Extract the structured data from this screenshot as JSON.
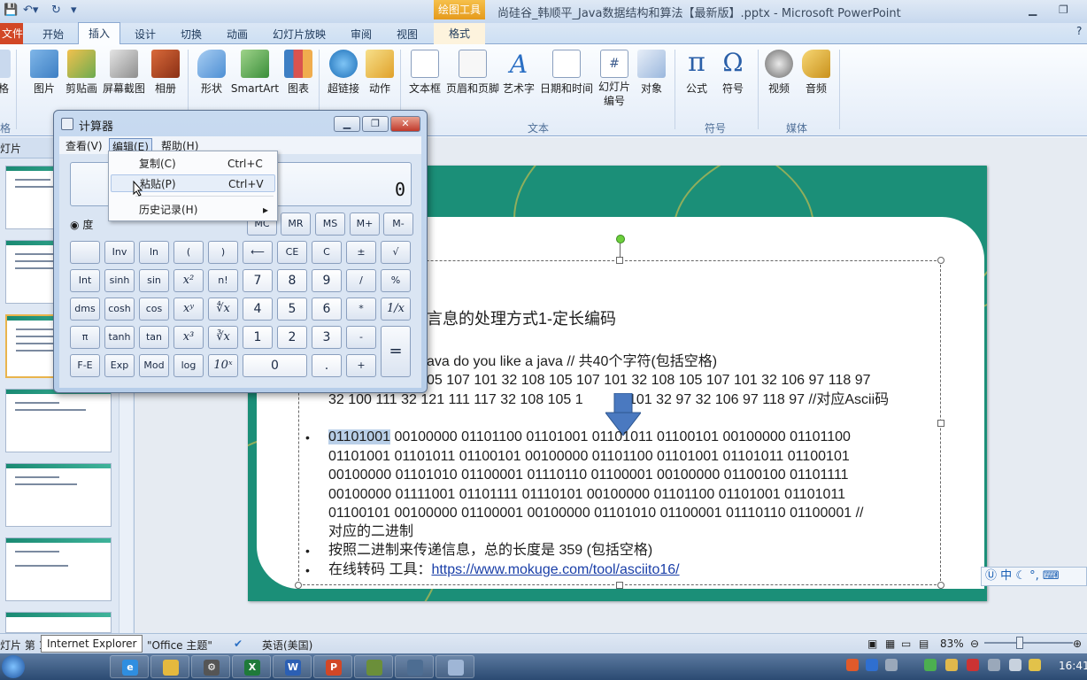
{
  "window": {
    "title": "尚硅谷_韩顺平_Java数据结构和算法【最新版】.pptx - Microsoft PowerPoint",
    "context_tab_group": "绘图工具"
  },
  "ribbon": {
    "tabs": {
      "file": "文件",
      "home": "开始",
      "insert": "插入",
      "design": "设计",
      "transitions": "切换",
      "animations": "动画",
      "slideshow": "幻灯片放映",
      "review": "审阅",
      "view": "视图",
      "format": "格式"
    },
    "buttons": {
      "table_partial": "格",
      "picture": "图片",
      "clipart": "剪贴画",
      "screenshot": "屏幕截图",
      "album": "相册",
      "shapes": "形状",
      "smartart": "SmartArt",
      "chart": "图表",
      "hyperlink": "超链接",
      "action": "动作",
      "textbox": "文本框",
      "header_footer": "页眉和页脚",
      "wordart": "艺术字",
      "datetime": "日期和时间",
      "slide_number_1": "幻灯片",
      "slide_number_2": "编号",
      "object": "对象",
      "equation": "公式",
      "symbol": "符号",
      "video": "视频",
      "audio": "音频"
    },
    "groups": {
      "table_partial": "格",
      "text": "文本",
      "symbols": "符号",
      "media": "媒体"
    }
  },
  "left_panel": {
    "tab_slides": "灯片"
  },
  "calculator": {
    "title": "计算器",
    "menu": {
      "view": "查看(V)",
      "edit": "编辑(E)",
      "help": "帮助(H)"
    },
    "display": "0",
    "radio_label": "度",
    "dropdown": {
      "copy": "复制(C)",
      "copy_shortcut": "Ctrl+C",
      "paste": "粘贴(P)",
      "paste_shortcut": "Ctrl+V",
      "history": "历史记录(H)",
      "history_arrow": "▸"
    },
    "keys": {
      "mc": "MC",
      "mr": "MR",
      "ms": "MS",
      "mplus": "M+",
      "mminus": "M-",
      "inv": "Inv",
      "ln": "ln",
      "lparen": "(",
      "rparen": ")",
      "back": "⟵",
      "ce": "CE",
      "c": "C",
      "pm": "±",
      "sqrt": "√",
      "int": "Int",
      "sinh": "sinh",
      "sin": "sin",
      "x2": "x²",
      "fact": "n!",
      "seven": "7",
      "eight": "8",
      "nine": "9",
      "div": "/",
      "pct": "%",
      "dms": "dms",
      "cosh": "cosh",
      "cos": "cos",
      "xy": "xʸ",
      "yroot": "∜x",
      "four": "4",
      "five": "5",
      "six": "6",
      "mul": "*",
      "recip": "1/x",
      "pi": "π",
      "tanh": "tanh",
      "tan": "tan",
      "x3": "x³",
      "cbrt": "∛x",
      "one": "1",
      "two": "2",
      "three": "3",
      "minus": "-",
      "equals": "=",
      "fe": "F-E",
      "exp": "Exp",
      "mod": "Mod",
      "log": "log",
      "tenx": "10ˣ",
      "zero": "0",
      "dot": ".",
      "plus": "+"
    }
  },
  "slide": {
    "title_fragment": "言息的处理方式1-定长编码",
    "line1": "ava do you like a java       // 共40个字符(包括空格)",
    "line2": "05 107 101 32 108 105 107 101 32 108 105 107 101 32 106 97 118 97",
    "line3": "32 100 111 32 121 111 117 32 108 105 1",
    "line3b": "101 32 97 32 106 97 118 97  //对应Ascii码",
    "binary_highlight": "01101001",
    "binary_l1": " 00100000 01101100 01101001 01101011 01100101 00100000 01101100",
    "binary_l2": "01101001 01101011 01100101 00100000 01101100 01101001 01101011 01100101",
    "binary_l3": "00100000 01101010 01100001 01110110 01100001 00100000 01100100 01101111",
    "binary_l4": "00100000 01111001 01101111 01110101 00100000 01101100 01101001 01101011",
    "binary_l5": "01100101 00100000 01100001 00100000 01101010 01100001 01110110 01100001 //",
    "binary_l6": "对应的二进制",
    "total_prefix": "按照二进制来传递信息，总的长度是  359  (包括空格)",
    "online_prefix": "在线转码 工具：",
    "online_link": "https://www.mokuge.com/tool/asciito16/",
    "bullet": "•"
  },
  "statusbar": {
    "slide_info": "灯片 第 1",
    "tooltip": "Internet Explorer",
    "theme": "\"Office 主题\"",
    "language": "英语(美国)",
    "zoom": "83%"
  },
  "ime": "中",
  "taskbar": {
    "clock": "16:41"
  },
  "colors": {
    "accent_file": "#d24726",
    "slide_bg": "#1b8f78",
    "link": "#1a3fa8"
  }
}
